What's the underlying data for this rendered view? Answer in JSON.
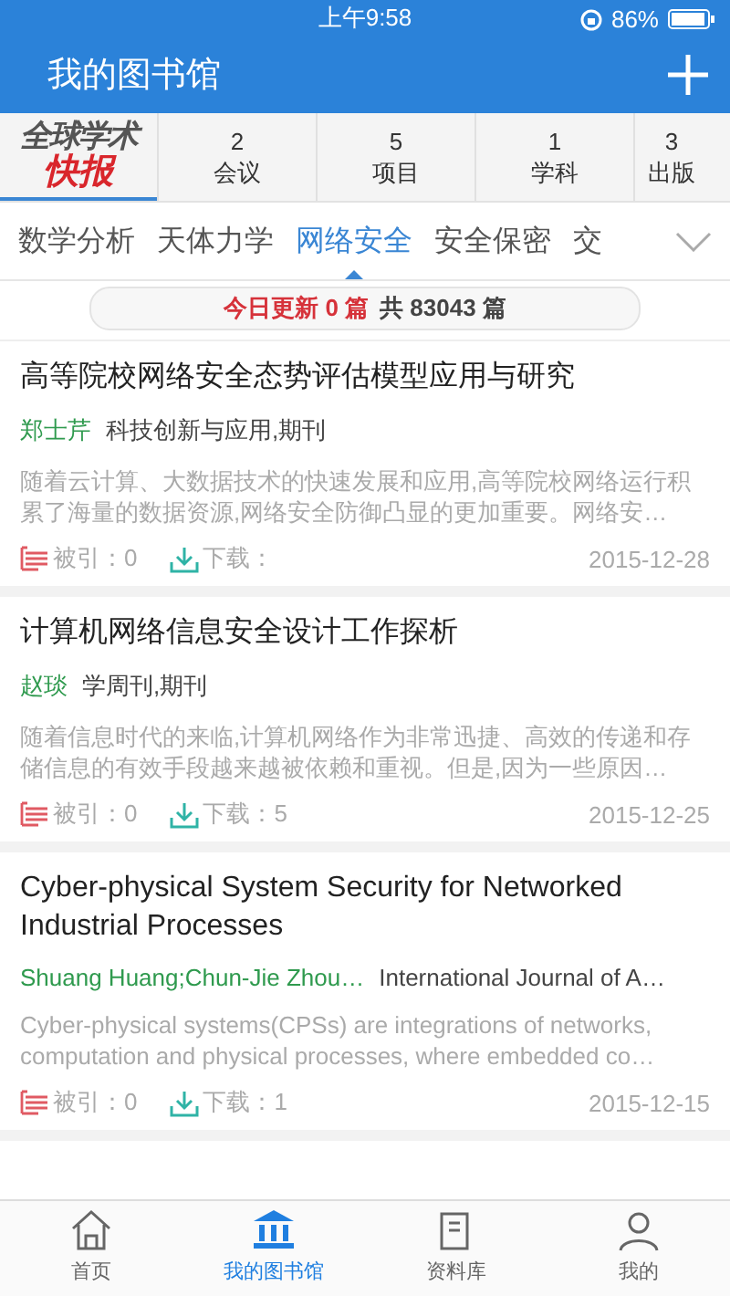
{
  "status_bar": {
    "time": "上午9:58",
    "battery": "86%"
  },
  "header": {
    "title": "我的图书馆"
  },
  "logo": {
    "line_1": "全球学术",
    "line_2": "快报",
    "selected": true
  },
  "stats": [
    {
      "count": "2",
      "label": "会议"
    },
    {
      "count": "5",
      "label": "项目"
    },
    {
      "count": "1",
      "label": "学科"
    },
    {
      "count": "3",
      "label": "出版"
    }
  ],
  "categories": [
    {
      "label": "数学分析",
      "selected": false
    },
    {
      "label": "天体力学",
      "selected": false
    },
    {
      "label": "网络安全",
      "selected": true
    },
    {
      "label": "安全保密",
      "selected": false
    },
    {
      "label": "交",
      "selected": false
    }
  ],
  "update_banner": {
    "today": "今日更新 0 篇",
    "total": "共 83043 篇"
  },
  "articles": [
    {
      "title": "高等院校网络安全态势评估模型应用与研究",
      "authors": "郑士芹",
      "source": "科技创新与应用,期刊",
      "abstract": "随着云计算、大数据技术的快速发展和应用,高等院校网络运行积累了海量的数据资源,网络安全防御凸显的更加重要。网络安…",
      "citations": "被引：0",
      "downloads": "下载：",
      "date": "2015-12-28"
    },
    {
      "title": "计算机网络信息安全设计工作探析",
      "authors": "赵琰",
      "source": "学周刊,期刊",
      "abstract": "随着信息时代的来临,计算机网络作为非常迅捷、高效的传递和存储信息的有效手段越来越被依赖和重视。但是,因为一些原因…",
      "citations": "被引：0",
      "downloads": "下载：5",
      "date": "2015-12-25"
    },
    {
      "title": "Cyber-physical System Security for Networked Industrial Processes",
      "authors": "Shuang Huang;Chun-Jie Zhou…",
      "source": "International Journal of A…",
      "abstract": "Cyber-physical systems(CPSs) are integrations of networks, computation and physical processes, where embedded co…",
      "citations": "被引：0",
      "downloads": "下载：1",
      "date": "2015-12-15"
    }
  ],
  "tab_bar": [
    {
      "kind": "home",
      "label": "首页",
      "selected": false
    },
    {
      "kind": "library",
      "label": "我的图书馆",
      "selected": true
    },
    {
      "kind": "database",
      "label": "资料库",
      "selected": false
    },
    {
      "kind": "profile",
      "label": "我的",
      "selected": false
    }
  ]
}
